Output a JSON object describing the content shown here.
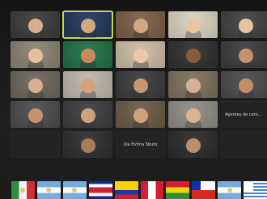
{
  "meeting": {
    "participants": [
      {
        "name": "",
        "active": false,
        "skin": "#d6b08d",
        "bg": "#3a3a3a"
      },
      {
        "name": "",
        "active": true,
        "skin": "#d5a680",
        "bg": "#1f3559"
      },
      {
        "name": "",
        "active": false,
        "skin": "#d3a77f",
        "bg": "#7a5d45"
      },
      {
        "name": "",
        "active": false,
        "skin": "#e8c59f",
        "bg": "#d9d1bf"
      },
      {
        "name": "",
        "active": false,
        "skin": "#e6c29f",
        "bg": "#404040"
      },
      {
        "name": "",
        "active": false,
        "skin": "#e3c0a0",
        "bg": "#8a8272"
      },
      {
        "name": "",
        "active": false,
        "skin": "#c88a58",
        "bg": "#1f6f45"
      },
      {
        "name": "",
        "active": false,
        "skin": "#e8c8a8",
        "bg": "#cbbba5"
      },
      {
        "name": "",
        "active": false,
        "skin": "#8b5a3b",
        "bg": "#2f2f2f"
      },
      {
        "name": "",
        "active": false,
        "skin": "#c5936c",
        "bg": "#3b3b3b"
      },
      {
        "name": "",
        "active": false,
        "skin": "#d9b090",
        "bg": "#6c655b"
      },
      {
        "name": "",
        "active": false,
        "skin": "#d3a47c",
        "bg": "#bdb6aa"
      },
      {
        "name": "",
        "active": false,
        "skin": "#c9956d",
        "bg": "#3a3a3a"
      },
      {
        "name": "",
        "active": false,
        "skin": "#d8b092",
        "bg": "#7c6f5c"
      },
      {
        "name": "",
        "active": false,
        "skin": "#c28e67",
        "bg": "#4a4a4a"
      },
      {
        "name": "",
        "active": false,
        "skin": "#c7936a",
        "bg": "#4b4b4b"
      },
      {
        "name": "",
        "active": false,
        "skin": "#d0a27c",
        "bg": "#3c3c3c"
      },
      {
        "name": "",
        "active": false,
        "skin": "#cfa07a",
        "bg": "#6b5a45"
      },
      {
        "name": "",
        "active": false,
        "skin": "#dcb390",
        "bg": "#8f8c86"
      },
      {
        "text_tile": true,
        "text": "Agentes de cam..."
      },
      {
        "text_tile": true,
        "text": ""
      },
      {
        "name": "",
        "active": false,
        "skin": "#a77a58",
        "bg": "#2d2d2d"
      },
      {
        "text_tile": true,
        "text": "Ula Evtina  Sbuto"
      },
      {
        "name": "",
        "active": false,
        "skin": "#b98e6d",
        "bg": "#2a2a2a"
      },
      {
        "text_tile": true,
        "text": ""
      }
    ]
  },
  "flags": [
    {
      "name": "mexico"
    },
    {
      "name": "argentina"
    },
    {
      "name": "argentina"
    },
    {
      "name": "costa-rica"
    },
    {
      "name": "colombia"
    },
    {
      "name": "peru"
    },
    {
      "name": "bolivia"
    },
    {
      "name": "chile"
    },
    {
      "name": "argentina"
    },
    {
      "name": "uruguay"
    }
  ],
  "colors": {
    "active_speaker_outline": "#c6db43",
    "background": "#1b1b1b"
  }
}
